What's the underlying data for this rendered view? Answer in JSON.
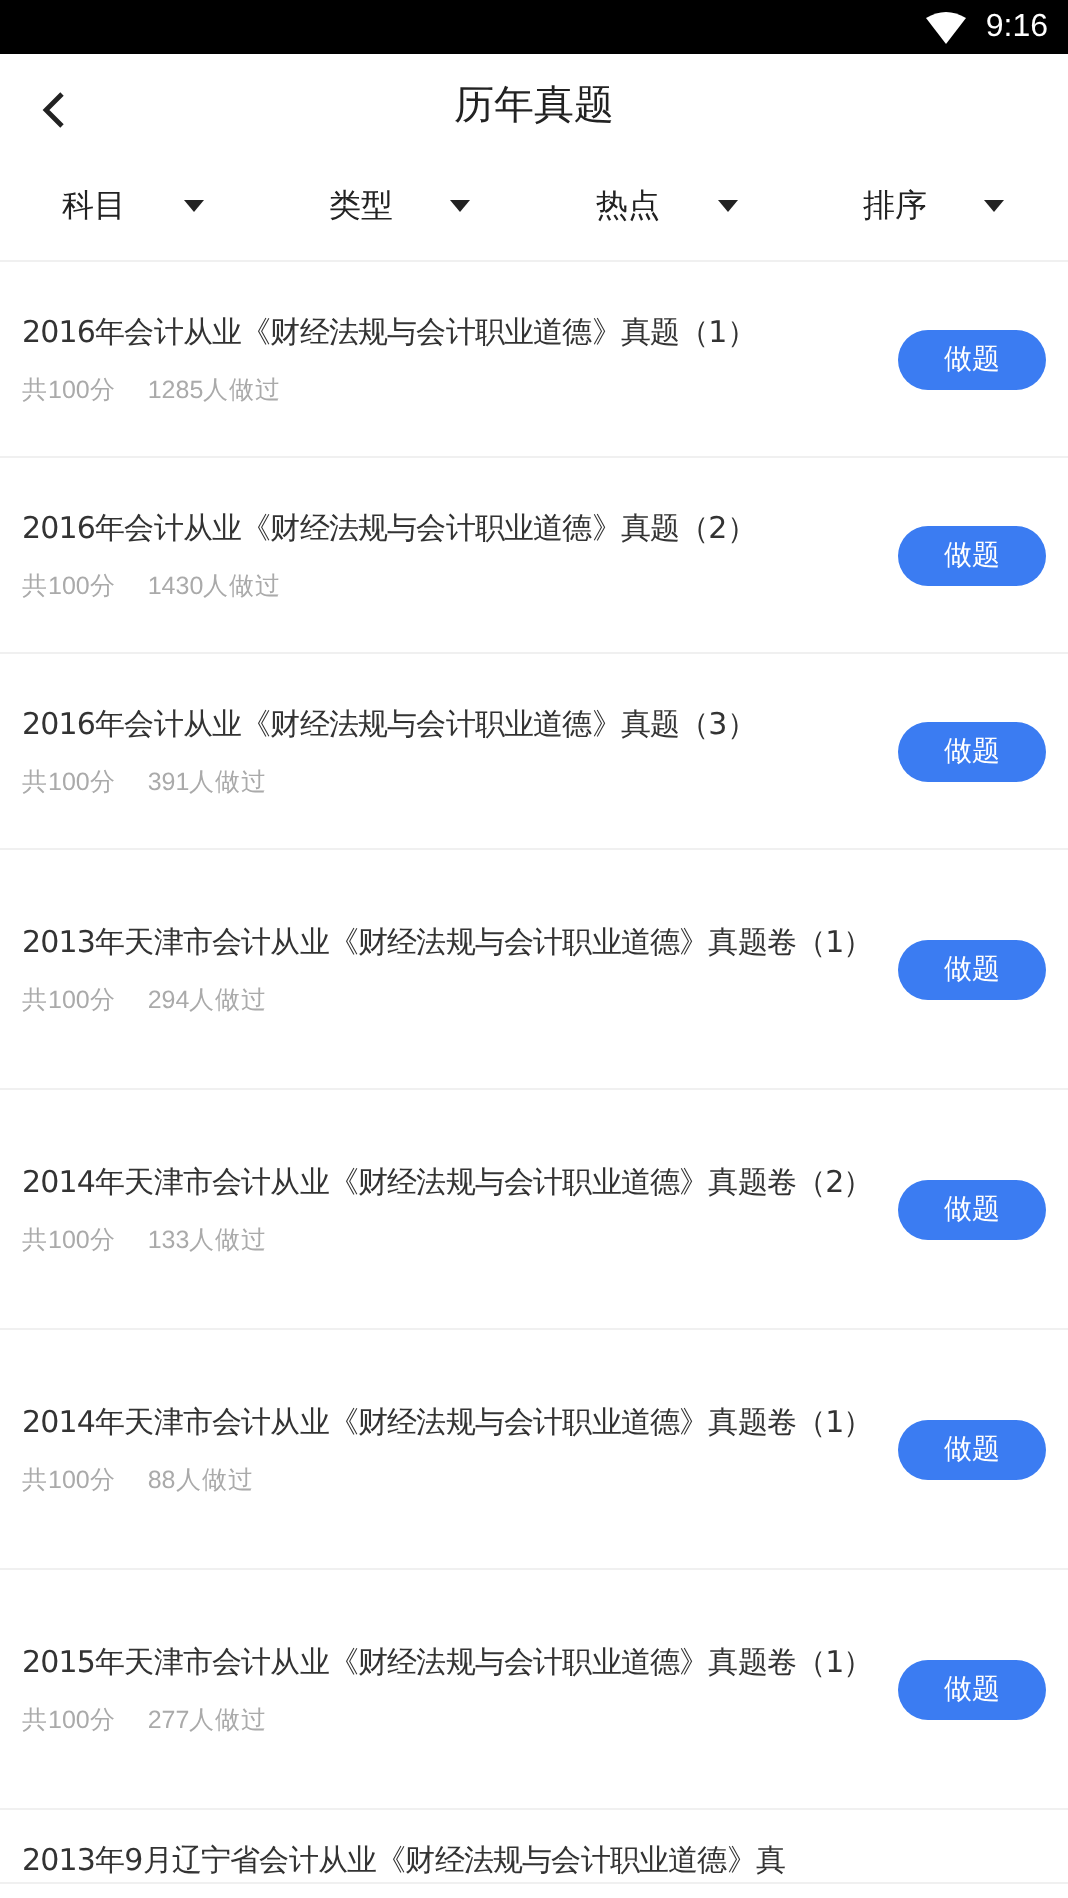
{
  "status_bar": {
    "time": "9:16"
  },
  "header": {
    "title": "历年真题"
  },
  "filters": [
    {
      "label": "科目"
    },
    {
      "label": "类型"
    },
    {
      "label": "热点"
    },
    {
      "label": "排序"
    }
  ],
  "papers": [
    {
      "title": "2016年会计从业《财经法规与会计职业道德》真题（1）",
      "score": "共100分",
      "done": "1285人做过",
      "button": "做题"
    },
    {
      "title": "2016年会计从业《财经法规与会计职业道德》真题（2）",
      "score": "共100分",
      "done": "1430人做过",
      "button": "做题"
    },
    {
      "title": "2016年会计从业《财经法规与会计职业道德》真题（3）",
      "score": "共100分",
      "done": "391人做过",
      "button": "做题"
    },
    {
      "title": "2013年天津市会计从业《财经法规与会计职业道德》真题卷（1）",
      "score": "共100分",
      "done": "294人做过",
      "button": "做题"
    },
    {
      "title": "2014年天津市会计从业《财经法规与会计职业道德》真题卷（2）",
      "score": "共100分",
      "done": "133人做过",
      "button": "做题"
    },
    {
      "title": "2014年天津市会计从业《财经法规与会计职业道德》真题卷（1）",
      "score": "共100分",
      "done": "88人做过",
      "button": "做题"
    },
    {
      "title": "2015年天津市会计从业《财经法规与会计职业道德》真题卷（1）",
      "score": "共100分",
      "done": "277人做过",
      "button": "做题"
    },
    {
      "title": "2013年9月辽宁省会计从业《财经法规与会计职业道德》真"
    }
  ]
}
